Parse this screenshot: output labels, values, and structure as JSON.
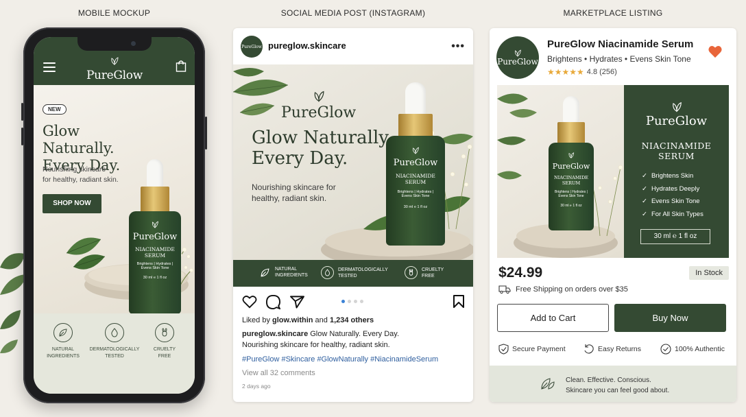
{
  "columns": {
    "mobile": "MOBILE MOCKUP",
    "social": "SOCIAL MEDIA POST (INSTAGRAM)",
    "marketplace": "MARKETPLACE LISTING"
  },
  "brand": {
    "name": "PureGlow",
    "dark_green": "#344a33",
    "cream": "#f3efe8",
    "gold": "#c9a24c"
  },
  "bottle_label": {
    "name": "PureGlow",
    "product_line1": "NIACINAMIDE",
    "product_line2": "SERUM",
    "benefits_line1": "Brightens | Hydrates |",
    "benefits_line2": "Evens Skin Tone",
    "volume": "30 ml ℮ 1 fl oz"
  },
  "mobile": {
    "badge": "NEW",
    "headline_line1": "Glow Naturally.",
    "headline_line2": "Every Day.",
    "subtext_line1": "Nourishing skincare",
    "subtext_line2": "for healthy, radiant skin.",
    "cta": "SHOP NOW",
    "badges": [
      {
        "line1": "NATURAL",
        "line2": "INGREDIENTS"
      },
      {
        "line1": "DERMATOLOGICALLY",
        "line2": "TESTED"
      },
      {
        "line1": "CRUELTY",
        "line2": "FREE"
      }
    ]
  },
  "instagram": {
    "username": "pureglow.skincare",
    "avatar_text": "PureGlow",
    "more": "•••",
    "headline_line1": "Glow Naturally.",
    "headline_line2": "Every Day.",
    "subtext_line1": "Nourishing skincare for",
    "subtext_line2": "healthy, radiant skin.",
    "band": [
      {
        "line1": "NATURAL",
        "line2": "INGREDIENTS"
      },
      {
        "line1": "DERMATOLOGICALLY",
        "line2": "TESTED"
      },
      {
        "line1": "CRUELTY",
        "line2": "FREE"
      }
    ],
    "carousel_dots": 4,
    "carousel_active": 1,
    "liked_prefix": "Liked by ",
    "liked_user": "glow.within",
    "liked_mid": " and ",
    "liked_count": "1,234 others",
    "caption_user": "pureglow.skincare",
    "caption_text": " Glow Naturally. Every Day.",
    "caption_line2": "Nourishing skincare for healthy, radiant skin.",
    "hashtags": "#PureGlow #Skincare #GlowNaturally #NiacinamideSerum",
    "comments": "View all 32 comments",
    "time": "2 days ago"
  },
  "marketplace": {
    "logo_text": "PureGlow",
    "title": "PureGlow Niacinamide Serum",
    "subtitle": "Brightens • Hydrates • Evens Skin Tone",
    "stars": "★★★★★",
    "rating_value": 4.8,
    "rating_text": "4.8 (256)",
    "panel_logo": "PureGlow",
    "panel_title_line1": "NIACINAMIDE",
    "panel_title_line2": "SERUM",
    "features": [
      "Brightens Skin",
      "Hydrates Deeply",
      "Evens Skin Tone",
      "For All Skin Types"
    ],
    "size": "30 ml ℮ 1 fl oz",
    "price": "$24.99",
    "stock": "In Stock",
    "shipping": "Free Shipping on orders over $35",
    "add_to_cart": "Add to Cart",
    "buy_now": "Buy Now",
    "trust": [
      "Secure Payment",
      "Easy Returns",
      "100% Authentic"
    ],
    "footer_line1": "Clean. Effective. Conscious.",
    "footer_line2": "Skincare you can feel good about.",
    "heart_color": "#e8653a"
  }
}
